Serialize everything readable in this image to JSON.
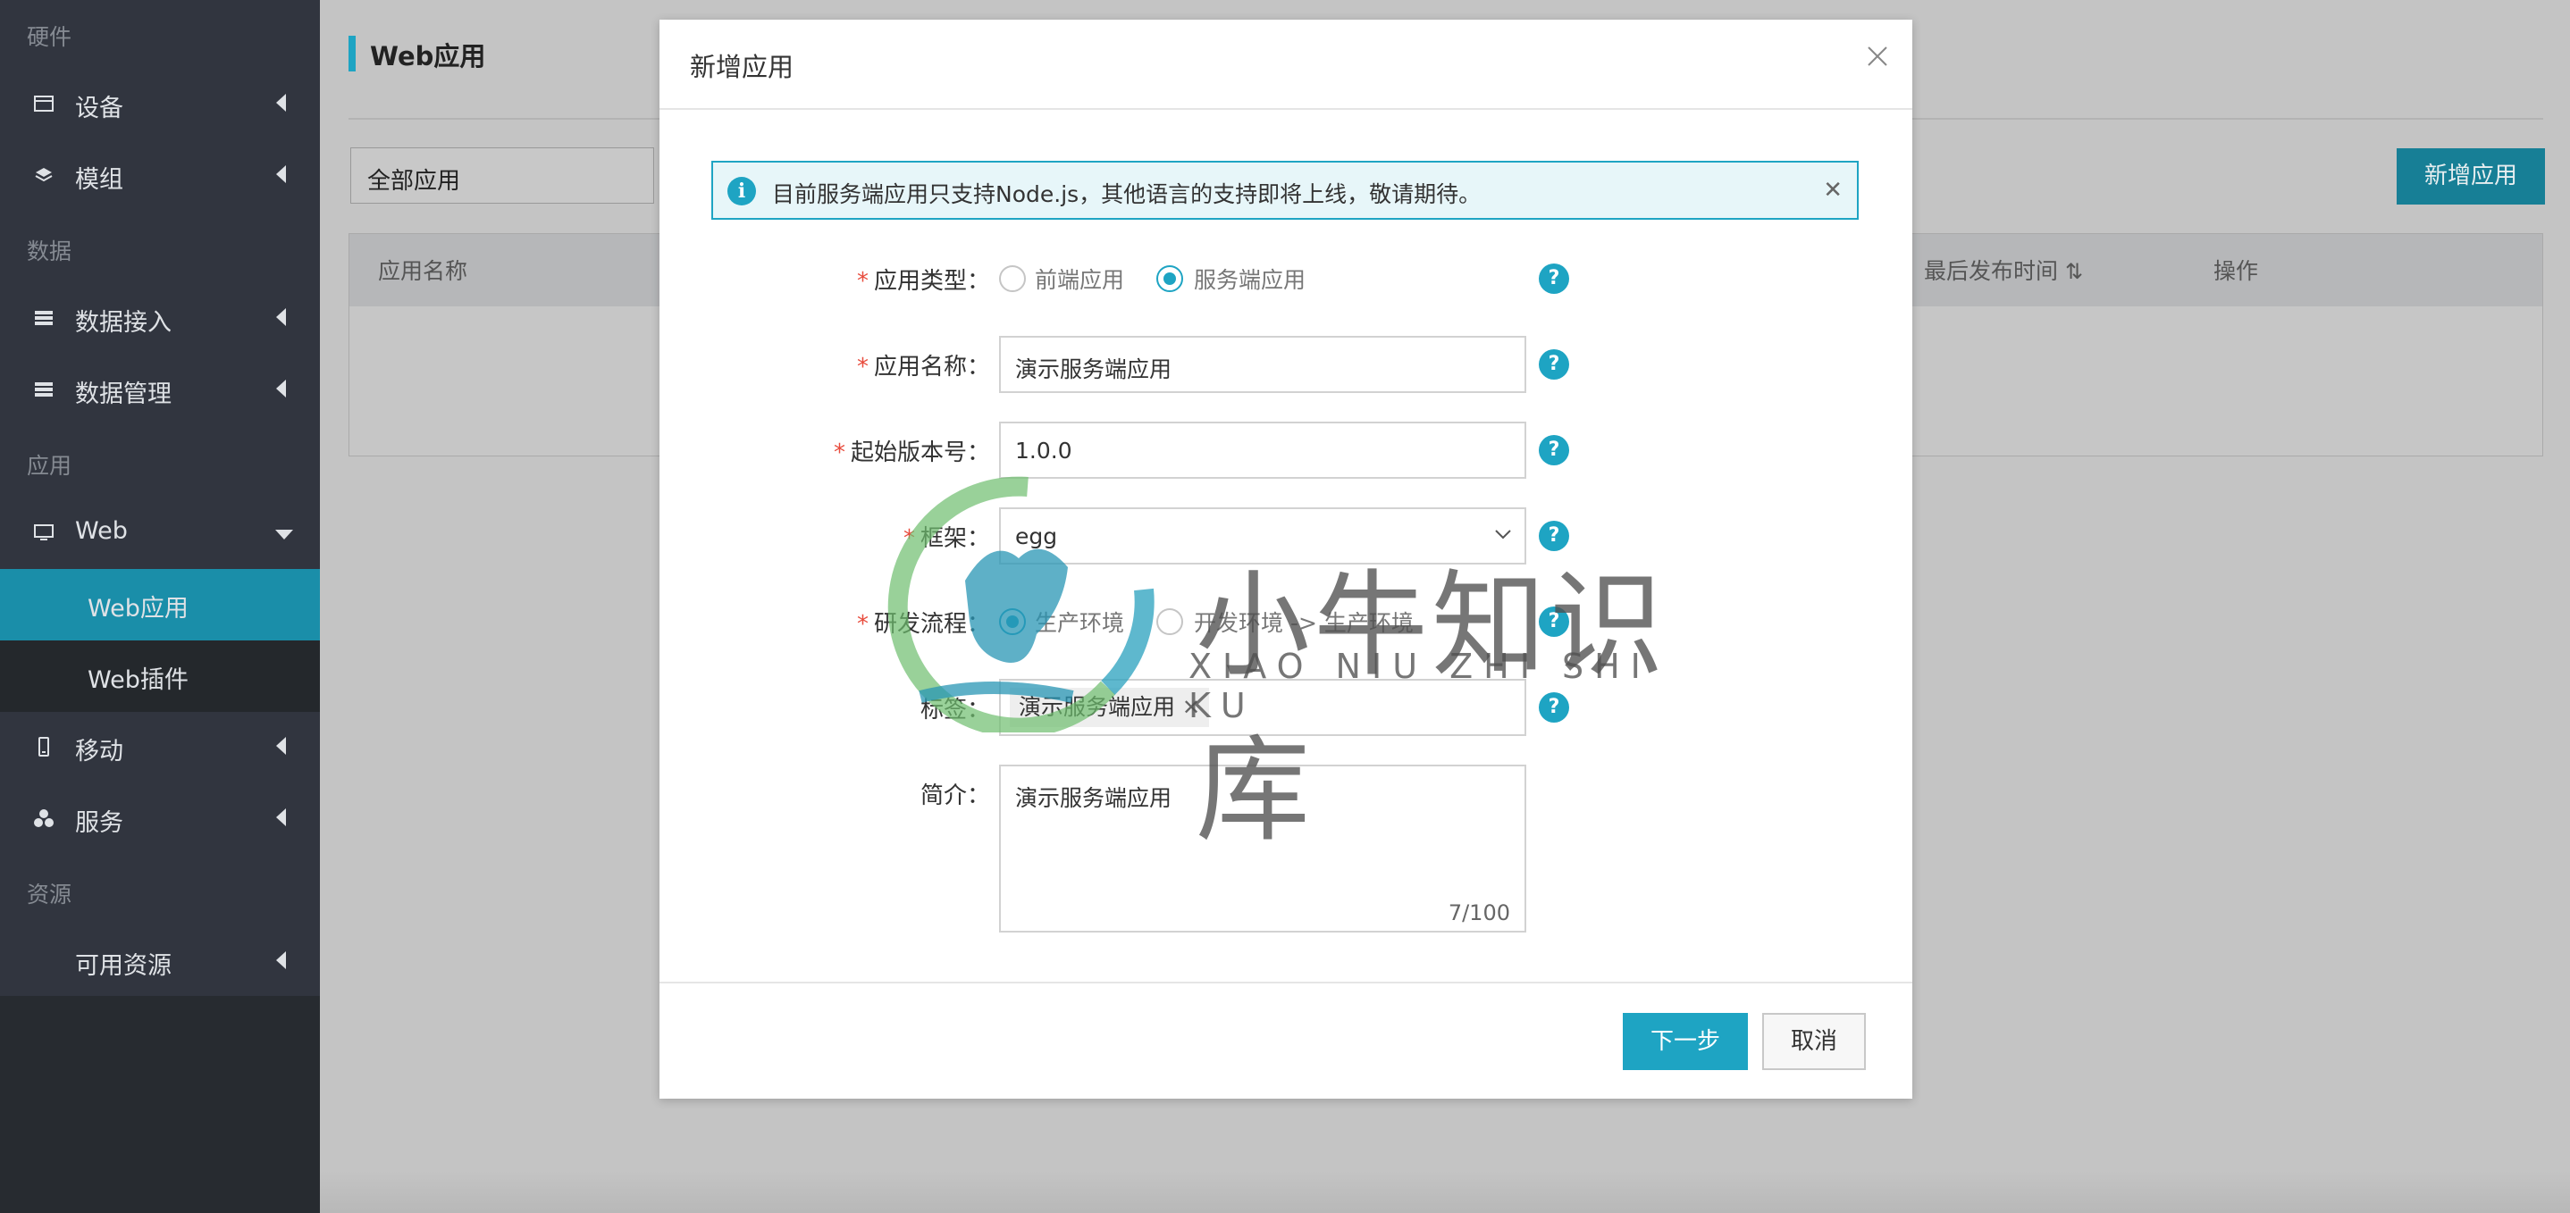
{
  "sidebar": {
    "sections": [
      "硬件",
      "数据",
      "应用",
      "资源"
    ],
    "items": [
      {
        "label": "设备",
        "icon": "monitor-icon"
      },
      {
        "label": "模组",
        "icon": "layers-icon"
      },
      {
        "label": "数据接入",
        "icon": "server-icon"
      },
      {
        "label": "数据管理",
        "icon": "server-icon"
      },
      {
        "label": "Web",
        "icon": "desktop-icon"
      },
      {
        "label": "移动",
        "icon": "phone-icon"
      },
      {
        "label": "服务",
        "icon": "cluster-icon"
      },
      {
        "label": "可用资源",
        "icon": ""
      }
    ],
    "sub_items": [
      {
        "label": "Web应用",
        "active": true
      },
      {
        "label": "Web插件",
        "active": false
      }
    ]
  },
  "page": {
    "title": "Web应用",
    "filter_value": "全部应用",
    "add_button": "新增应用",
    "table_headers": [
      "应用名称",
      "最后发布时间",
      "操作"
    ]
  },
  "dialog": {
    "title": "新增应用",
    "notice": "目前服务端应用只支持Node.js，其他语言的支持即将上线，敬请期待。",
    "fields": {
      "type_label": "应用类型：",
      "type_options": [
        "前端应用",
        "服务端应用"
      ],
      "name_label": "应用名称：",
      "name_value": "演示服务端应用",
      "version_label": "起始版本号：",
      "version_value": "1.0.0",
      "framework_label": "框架：",
      "framework_value": "egg",
      "process_label": "研发流程：",
      "process_options": [
        "生产环境",
        "开发环境 -> 生产环境"
      ],
      "tags_label": "标签：",
      "tag_value": "演示服务端应用",
      "desc_label": "简介：",
      "desc_value": "演示服务端应用",
      "desc_count": "7/100"
    },
    "help_glyph": "?",
    "next_button": "下一步",
    "cancel_button": "取消"
  },
  "watermark": {
    "text": "小牛知识库",
    "subtext": "XIAO NIU ZHI SHI KU"
  },
  "colors": {
    "accent": "#1ea4c3",
    "sidebar_bg": "#31353f",
    "required": "#e84c3d"
  }
}
